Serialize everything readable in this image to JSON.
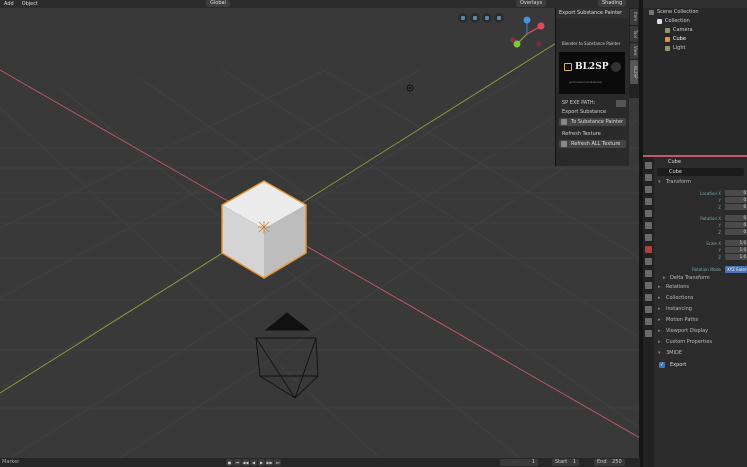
{
  "topbar": {
    "menu": [
      "Add",
      "Object"
    ],
    "orientation": "Global",
    "overlays": "Overlays",
    "shading": "Shading"
  },
  "viewport": {
    "nav_icons": [
      "zoom-icon",
      "pan-icon",
      "camera-view-icon",
      "perspective-icon"
    ],
    "gizmo_axes": [
      "X",
      "Y",
      "Z"
    ]
  },
  "npanel": {
    "header": "Export Substance Painter",
    "logo_title": "Blender to Substance Painter",
    "logo_text": "BL2SP",
    "logo_tagline": "gumroad.com/blender",
    "sp_exe_path_label": "SP EXE PATH:",
    "export_substance_label": "Export Substance",
    "to_substance_painter": "To Substance Painter",
    "refresh_texture_label": "Refresh Texture",
    "refresh_all_texture": "Refresh ALL Texture",
    "tabs": [
      "Item",
      "Tool",
      "View",
      "BL2SP"
    ]
  },
  "outliner": {
    "scene_collection": "Scene Collection",
    "collection": "Collection",
    "items": [
      "Camera",
      "Cube",
      "Light"
    ]
  },
  "properties": {
    "object_name": "Cube",
    "name_field": "Cube",
    "transform": "Transform",
    "location_label": "Location X",
    "rotation_label": "Rotation X",
    "scale_label": "Scale X",
    "axis_y": "Y",
    "axis_z": "Z",
    "loc_values": [
      "0",
      "0",
      "0"
    ],
    "rot_values": [
      "0",
      "0",
      "0"
    ],
    "scale_values": [
      "1.0",
      "1.0",
      "1.0"
    ],
    "rotation_mode_label": "Rotation Mode",
    "rotation_mode_value": "XYZ Euler",
    "delta_transform": "Delta Transform",
    "sections": [
      "Relations",
      "Collections",
      "Instancing",
      "Motion Paths",
      "Viewport Display",
      "Custom Properties",
      "3MIDE"
    ],
    "export_checkbox": "Export",
    "export_checkmark": "✓"
  },
  "timeline": {
    "left_label": "Marker",
    "current_frame": "1",
    "start_label": "Start",
    "start_value": "1",
    "end_label": "End",
    "end_value": "250",
    "buttons": [
      "●",
      "⏮",
      "◀◀",
      "◀",
      "▶",
      "▶▶",
      "⏭"
    ]
  },
  "colors": {
    "selection_orange": "#e8932e",
    "x_axis_red": "#c2596a",
    "y_axis_green": "#8aa03a",
    "accent_blue": "#4772b3"
  }
}
